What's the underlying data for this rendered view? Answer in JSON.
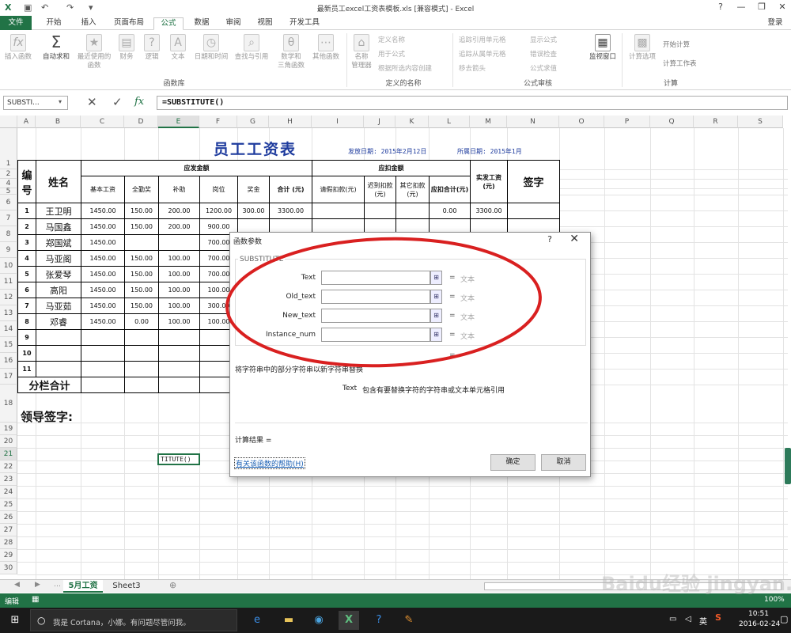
{
  "window": {
    "title": "最新员工excel工资表模板.xls [兼容模式] - Excel",
    "login": "登录"
  },
  "menu": [
    "开始",
    "插入",
    "页面布局",
    "公式",
    "数据",
    "审阅",
    "视图",
    "开发工具"
  ],
  "menu_active_index": 3,
  "file_label": "文件",
  "ribbon": {
    "insert_function": "插入函数",
    "autosum": "自动求和",
    "recent": "最近使用的\n函数",
    "finance": "财务",
    "logic": "逻辑",
    "text": "文本",
    "datetime": "日期和时间",
    "lookup": "查找与引用",
    "math": "数学和\n三角函数",
    "other": "其他函数",
    "name_manager": "名称\n管理器",
    "define_name": "定义名称",
    "use_in_formula": "用于公式",
    "create_from_sel": "根据所选内容创建",
    "trace_precedents": "追踪引用单元格",
    "trace_dependents": "追踪从属单元格",
    "remove_arrows": "移去箭头",
    "show_formulas": "显示公式",
    "error_checking": "错误检查",
    "evaluate_formula": "公式求值",
    "watch_window": "监视窗口",
    "calc_options": "计算选项",
    "calc_now": "开始计算",
    "calc_sheet": "计算工作表",
    "group_function_lib": "函数库",
    "group_defined_names": "定义的名称",
    "group_formula_audit": "公式审核",
    "group_calc": "计算"
  },
  "formula_bar": {
    "name_box": "SUBSTI...",
    "formula": "=SUBSTITUTE()"
  },
  "columns": [
    "A",
    "B",
    "C",
    "D",
    "E",
    "F",
    "G",
    "H",
    "I",
    "J",
    "K",
    "L",
    "M",
    "N",
    "O",
    "P",
    "Q",
    "R",
    "S"
  ],
  "selected_column": "E",
  "rows": [
    "1",
    "2",
    "4",
    "5",
    "6",
    "7",
    "8",
    "9",
    "10",
    "11",
    "12",
    "13",
    "14",
    "15",
    "16",
    "17",
    "18",
    "19",
    "20",
    "21",
    "22",
    "23",
    "24",
    "25",
    "26",
    "27",
    "28",
    "29",
    "30"
  ],
  "sheet": {
    "title": "员工工资表",
    "issue_date": "发放日期: 2015年2月12日",
    "period": "所属日期: 2015年1月",
    "h_no": "编号",
    "h_name": "姓名",
    "h_payable": "应发金额",
    "h_deduct": "应扣金额",
    "h_net": "实发工资(元)",
    "h_sign": "签字",
    "sub_headers": [
      "基本工资",
      "全勤奖",
      "补助",
      "岗位",
      "奖金",
      "合计 (元)",
      "请假扣款(元)",
      "迟到扣款(元)",
      "其它扣款(元)",
      "应扣合计(元)"
    ],
    "subtotal_label": "分栏合计",
    "leader_sign": "领导签字:",
    "active_cell_text": "TITUTE()",
    "employees": [
      {
        "no": "1",
        "name": "王卫明",
        "base": "1450.00",
        "att": "150.00",
        "sub": "200.00",
        "pos": "1200.00",
        "bonus": "300.00",
        "total": "3300.00",
        "ded": "0.00",
        "net": "3300.00"
      },
      {
        "no": "2",
        "name": "马国鑫",
        "base": "1450.00",
        "att": "150.00",
        "sub": "200.00",
        "pos": "900.00",
        "bonus": "",
        "total": "",
        "ded": "",
        "net": ""
      },
      {
        "no": "3",
        "name": "郑国斌",
        "base": "1450.00",
        "att": "",
        "sub": "",
        "pos": "700.00",
        "bonus": "",
        "total": "",
        "ded": "",
        "net": ""
      },
      {
        "no": "4",
        "name": "马亚阁",
        "base": "1450.00",
        "att": "150.00",
        "sub": "100.00",
        "pos": "700.00",
        "bonus": "",
        "total": "",
        "ded": "",
        "net": ""
      },
      {
        "no": "5",
        "name": "张爱琴",
        "base": "1450.00",
        "att": "150.00",
        "sub": "100.00",
        "pos": "700.00",
        "bonus": "",
        "total": "",
        "ded": "",
        "net": ""
      },
      {
        "no": "6",
        "name": "高阳",
        "base": "1450.00",
        "att": "150.00",
        "sub": "100.00",
        "pos": "100.00",
        "bonus": "",
        "total": "",
        "ded": "",
        "net": ""
      },
      {
        "no": "7",
        "name": "马亚茹",
        "base": "1450.00",
        "att": "150.00",
        "sub": "100.00",
        "pos": "300.00",
        "bonus": "",
        "total": "",
        "ded": "",
        "net": ""
      },
      {
        "no": "8",
        "name": "邓睿",
        "base": "1450.00",
        "att": "0.00",
        "sub": "100.00",
        "pos": "100.00",
        "bonus": "",
        "total": "",
        "ded": "",
        "net": ""
      },
      {
        "no": "9",
        "name": "",
        "base": "",
        "att": "",
        "sub": "",
        "pos": "",
        "bonus": "",
        "total": "",
        "ded": "",
        "net": ""
      },
      {
        "no": "10",
        "name": "",
        "base": "",
        "att": "",
        "sub": "",
        "pos": "",
        "bonus": "",
        "total": "",
        "ded": "",
        "net": ""
      },
      {
        "no": "11",
        "name": "",
        "base": "",
        "att": "",
        "sub": "",
        "pos": "",
        "bonus": "",
        "total": "",
        "ded": "",
        "net": ""
      }
    ]
  },
  "dialog": {
    "title": "函数参数",
    "help_q": "?",
    "function_name": "SUBSTITUTE",
    "args": [
      {
        "label": "Text",
        "value": "文本"
      },
      {
        "label": "Old_text",
        "value": "文本"
      },
      {
        "label": "New_text",
        "value": "文本"
      },
      {
        "label": "Instance_num",
        "value": "文本"
      }
    ],
    "eq": "=",
    "description": "将字符串中的部分字符串以新字符串替换",
    "arg_help_name": "Text",
    "arg_help": "包含有要替换字符的字符串或文本单元格引用",
    "result_label": "计算结果 =",
    "help_link": "有关该函数的帮助(H)",
    "ok": "确定",
    "cancel": "取消"
  },
  "sheet_tabs": [
    "5月工资",
    "Sheet3"
  ],
  "status": {
    "mode": "编辑",
    "zoom": "100%"
  },
  "taskbar": {
    "cortana": "我是 Cortana，小娜。有问题尽管问我。",
    "lang": "英",
    "time": "10:51",
    "date": "2016-02-24"
  },
  "watermark": "Baidu经验 jingyan.baidu.com",
  "colors": {
    "excel_green": "#217346",
    "title_blue": "#1f3c9e",
    "annotation_red": "#d92020"
  }
}
